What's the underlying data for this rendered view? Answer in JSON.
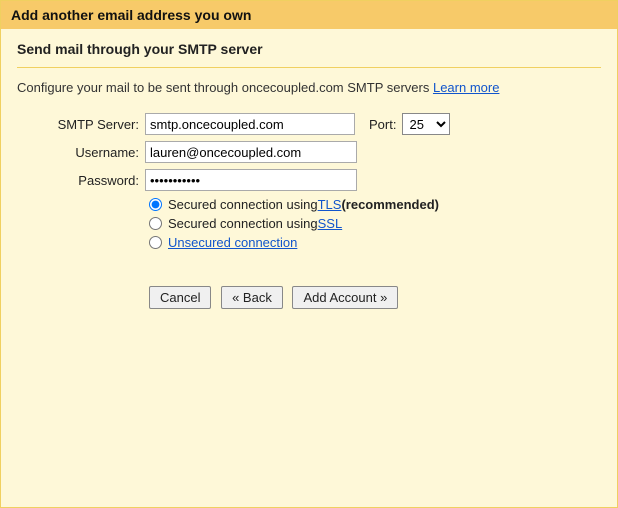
{
  "window": {
    "title": "Add another email address you own"
  },
  "subtitle": "Send mail through your SMTP server",
  "description": {
    "text": "Configure your mail to be sent through oncecoupled.com SMTP servers ",
    "learn_more": "Learn more"
  },
  "form": {
    "smtp_label": "SMTP Server:",
    "smtp_value": "smtp.oncecoupled.com",
    "port_label": "Port:",
    "port_value": "25",
    "username_label": "Username:",
    "username_value": "lauren@oncecoupled.com",
    "password_label": "Password:",
    "password_value": "•••••••••••"
  },
  "security": {
    "option1_prefix": "Secured connection using ",
    "option1_link": "TLS",
    "option1_suffix": " (recommended)",
    "option2_prefix": "Secured connection using ",
    "option2_link": "SSL",
    "option3_link": "Unsecured connection"
  },
  "buttons": {
    "cancel": "Cancel",
    "back": "« Back",
    "add": "Add Account »"
  }
}
